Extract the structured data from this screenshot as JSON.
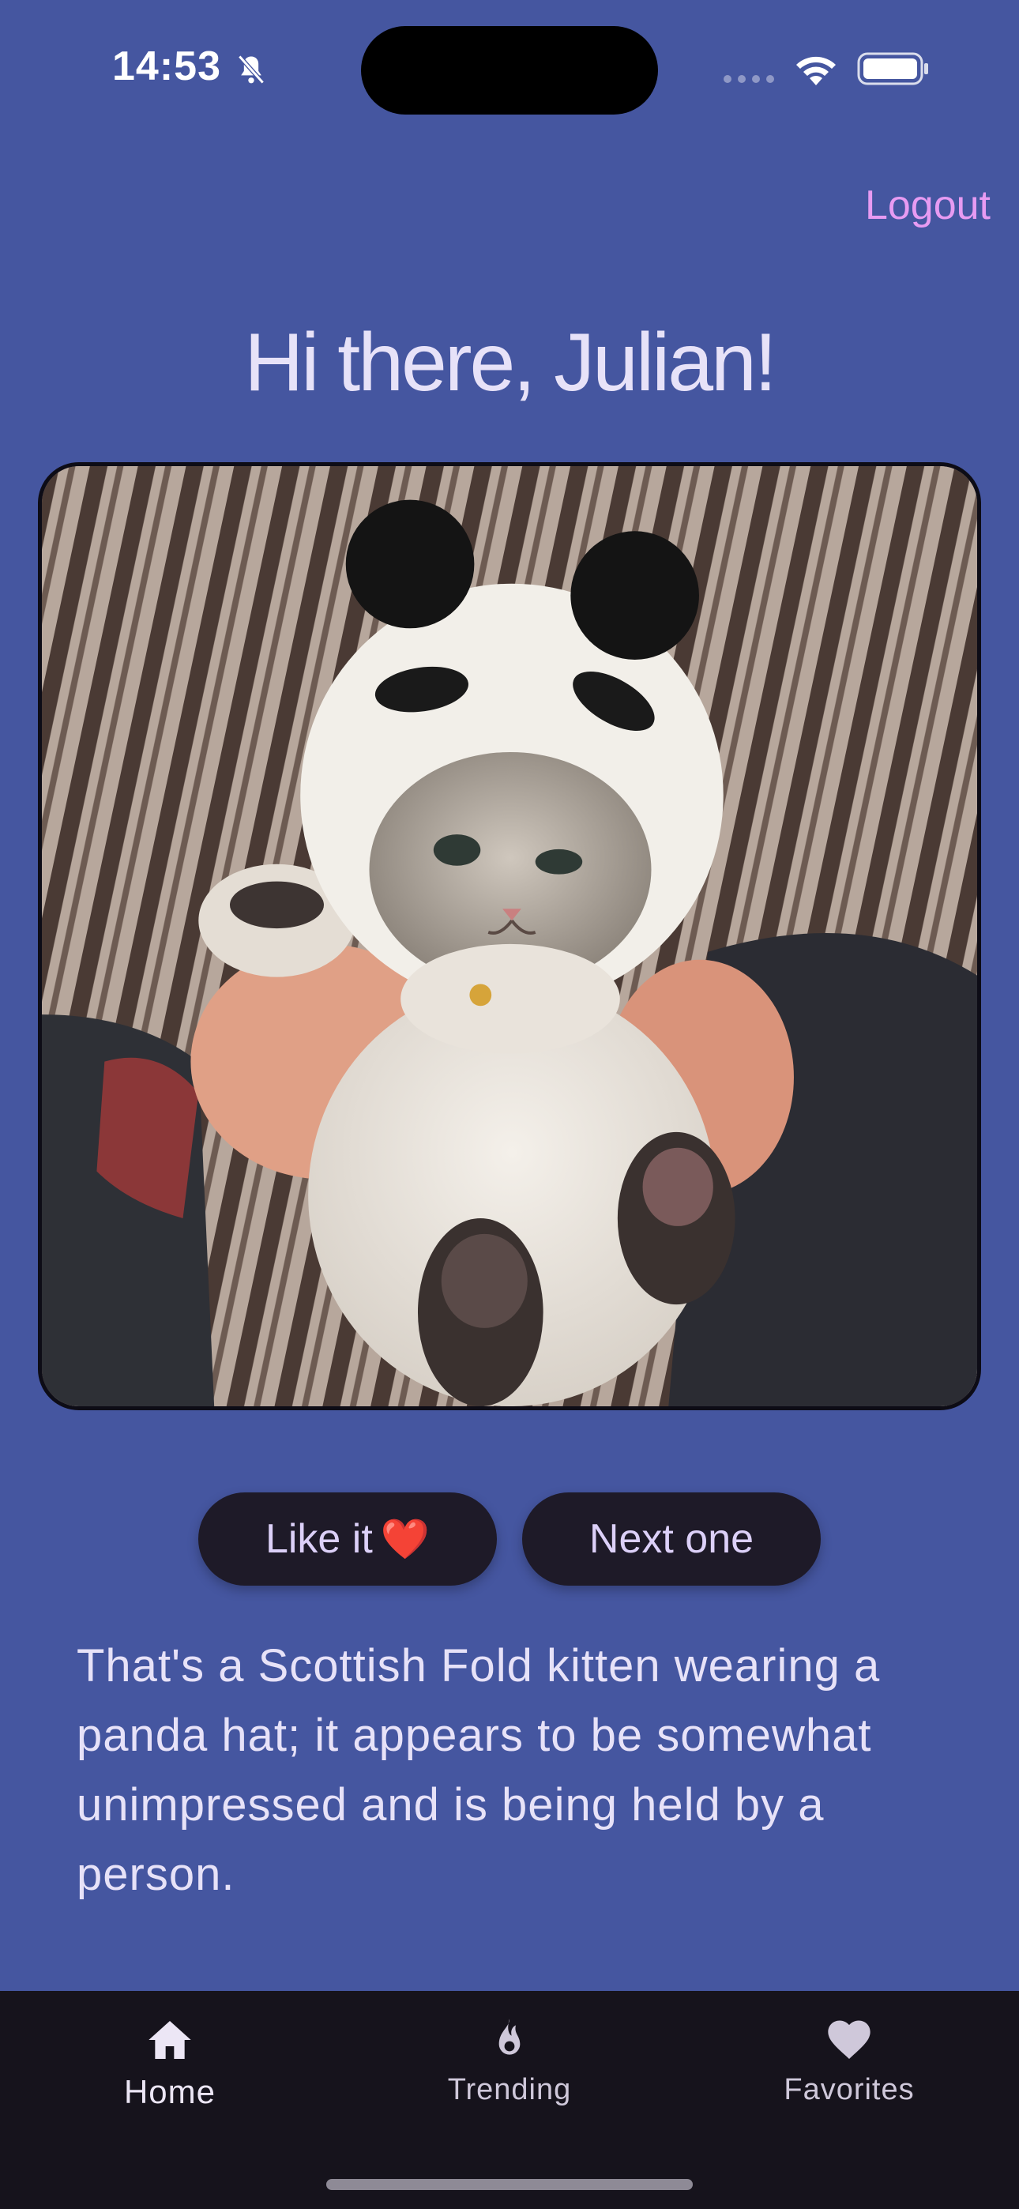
{
  "status_bar": {
    "time": "14:53",
    "icons": [
      "bell-slash-icon",
      "cellular-signal-icon",
      "wifi-icon",
      "battery-icon"
    ]
  },
  "header": {
    "logout_label": "Logout"
  },
  "greeting": "Hi there, Julian!",
  "photo": {
    "subject": "cat-photo"
  },
  "actions": {
    "like_label": "Like it",
    "like_emoji": "❤️",
    "next_label": "Next one"
  },
  "description": "That's a Scottish Fold kitten wearing a panda hat; it appears to be somewhat unimpressed and is being held by a person.",
  "bottom_nav": {
    "items": [
      {
        "label": "Home",
        "icon": "home-icon"
      },
      {
        "label": "Trending",
        "icon": "flame-icon"
      },
      {
        "label": "Favorites",
        "icon": "heart-icon"
      }
    ]
  },
  "colors": {
    "background": "#4556A0",
    "accent": "#E79BF2",
    "button_bg": "#1E1A28",
    "nav_bg": "#16131C"
  }
}
